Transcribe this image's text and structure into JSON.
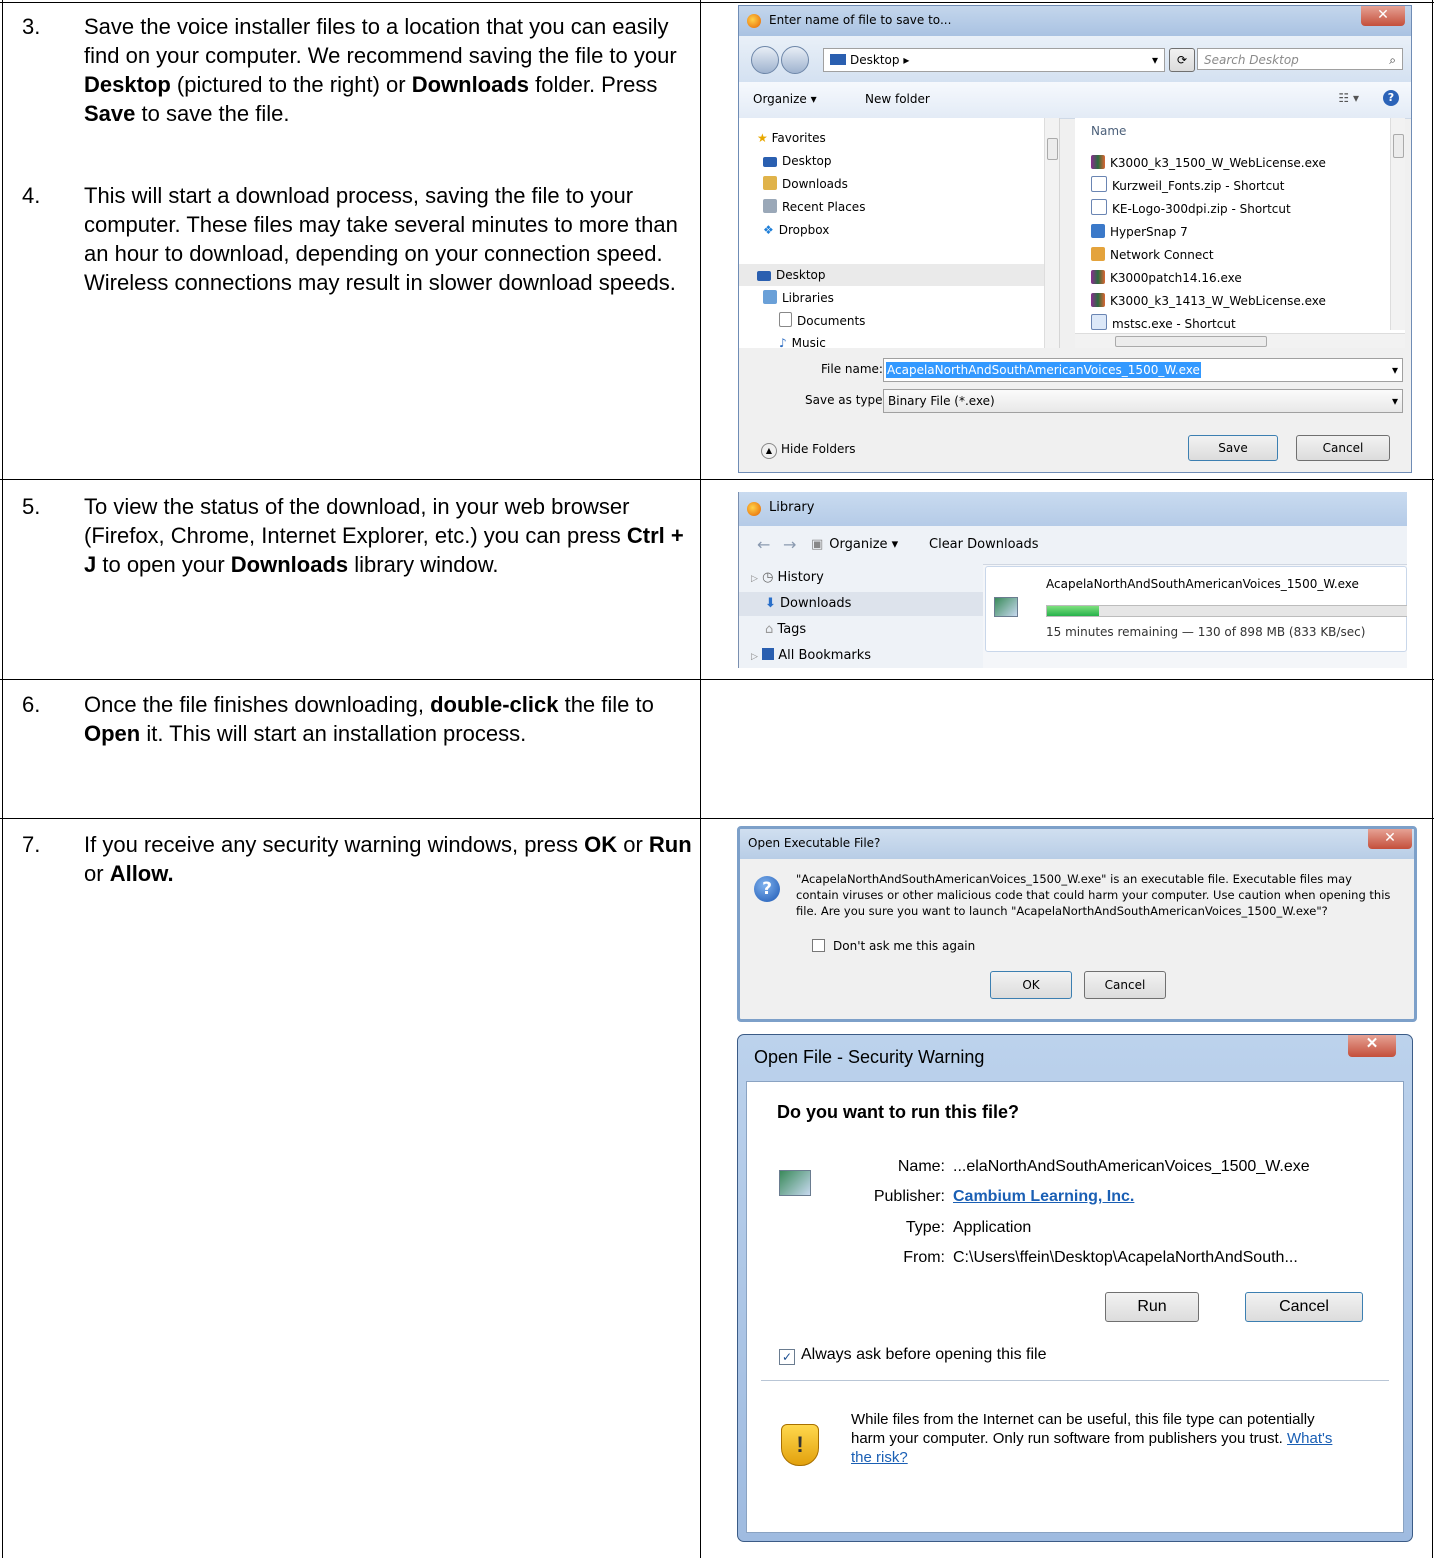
{
  "steps": [
    {
      "num": "3.",
      "parts": [
        "Save the voice installer files to a location that you can easily find on your computer. We recommend saving the file to your ",
        "Desktop",
        " (pictured to the right)  or ",
        "Downloads",
        " folder. Press ",
        "Save",
        " to save the file."
      ]
    },
    {
      "num": "4.",
      "text": "This will start a download process, saving the file to your computer. These files may take several minutes  to more than an hour to download, depending on your  connection speed. Wireless connections may result in  slower download speeds."
    },
    {
      "num": "5.",
      "parts": [
        "To view the status of the download, in your web browser (Firefox, Chrome, Internet Explorer, etc.) you  can press ",
        "Ctrl + J",
        " to  open your ",
        "Downloads",
        " library  window."
      ]
    },
    {
      "num": "6.",
      "parts": [
        "Once the file finishes downloading, ",
        "double-click",
        " the file to ",
        "Open",
        " it. This will start an installation process."
      ]
    },
    {
      "num": "7.",
      "parts": [
        "If you receive any security warning windows, press ",
        "OK",
        " or ",
        "Run",
        " or ",
        "Allow."
      ]
    }
  ],
  "save_dialog": {
    "title": "Enter name of file to save to...",
    "breadcrumb": "Desktop",
    "search_placeholder": "Search Desktop",
    "organize": "Organize ▾",
    "new_folder": "New folder",
    "nav_items": [
      {
        "label": "Favorites",
        "icon": "star-icon"
      },
      {
        "label": "Desktop",
        "icon": "desktop-icon"
      },
      {
        "label": "Downloads",
        "icon": "downloads-folder-icon"
      },
      {
        "label": "Recent Places",
        "icon": "recent-places-icon"
      },
      {
        "label": "Dropbox",
        "icon": "dropbox-icon"
      },
      {
        "label": "Desktop",
        "icon": "desktop-icon"
      },
      {
        "label": "Libraries",
        "icon": "libraries-icon"
      },
      {
        "label": "Documents",
        "icon": "documents-icon"
      },
      {
        "label": "Music",
        "icon": "music-icon"
      }
    ],
    "column_header": "Name",
    "files": [
      "K3000_k3_1500_W_WebLicense.exe",
      "Kurzweil_Fonts.zip - Shortcut",
      "KE-Logo-300dpi.zip - Shortcut",
      "HyperSnap 7",
      "Network Connect",
      "K3000patch14.16.exe",
      "K3000_k3_1413_W_WebLicense.exe",
      "mstsc.exe - Shortcut"
    ],
    "file_name_label": "File name:",
    "file_name_value": "AcapelaNorthAndSouthAmericanVoices_1500_W.exe",
    "save_type_label": "Save as type:",
    "save_type_value": "Binary File (*.exe)",
    "hide_folders": "Hide Folders",
    "save_button": "Save",
    "cancel_button": "Cancel"
  },
  "library": {
    "title": "Library",
    "organize": "Organize ▾",
    "clear_downloads": "Clear Downloads",
    "nav_items": [
      "History",
      "Downloads",
      "Tags",
      "All Bookmarks"
    ],
    "download_name": "AcapelaNorthAndSouthAmericanVoices_1500_W.exe",
    "download_status": "15 minutes remaining — 130 of 898 MB (833 KB/sec)",
    "progress_fraction": 0.145
  },
  "exe_dialog": {
    "title": "Open Executable File?",
    "message": "\"AcapelaNorthAndSouthAmericanVoices_1500_W.exe\" is an executable file. Executable files may contain viruses or other malicious code that could harm your computer. Use caution when opening this file. Are you sure you want to launch \"AcapelaNorthAndSouthAmericanVoices_1500_W.exe\"?",
    "checkbox_label": "Don't ask me this again",
    "ok_button": "OK",
    "cancel_button": "Cancel"
  },
  "security_warning": {
    "title": "Open File - Security Warning",
    "question": "Do you want to run this file?",
    "name_label": "Name:",
    "name_value": "...elaNorthAndSouthAmericanVoices_1500_W.exe",
    "publisher_label": "Publisher:",
    "publisher_value": "Cambium Learning, Inc.",
    "type_label": "Type:",
    "type_value": "Application",
    "from_label": "From:",
    "from_value": "C:\\Users\\ffein\\Desktop\\AcapelaNorthAndSouth...",
    "run_button": "Run",
    "cancel_button": "Cancel",
    "always_ask_label": "Always ask before opening this file",
    "warning_text": "While files from the Internet can be useful, this file type can potentially harm your computer. Only run software from publishers you trust. ",
    "risk_link": "What's the risk?"
  }
}
